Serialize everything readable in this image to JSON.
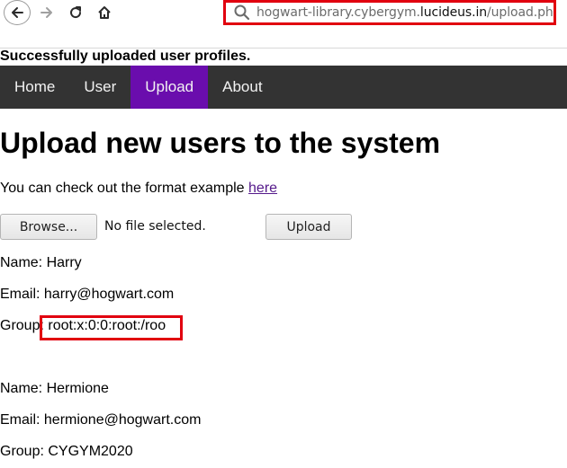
{
  "browser": {
    "url_prefix": "hogwart-library.cybergym.",
    "url_domain": "lucideus.in",
    "url_path": "/upload.php",
    "icons": [
      "back-arrow-icon",
      "forward-arrow-icon",
      "reload-icon",
      "home-icon",
      "search-icon"
    ],
    "highlight_color": "#e1000f"
  },
  "page": {
    "success_message": "Successfully uploaded user profiles.",
    "nav": [
      "Home",
      "User",
      "Upload",
      "About"
    ],
    "active_nav": "Upload",
    "nav_active_color": "#6a0dad",
    "title": "Upload new users to the system",
    "format_text": "You can check out the format example ",
    "format_link": "here",
    "browse_label": "Browse...",
    "file_status": "No file selected.",
    "upload_label": "Upload"
  },
  "users": [
    {
      "name": "Name: Harry",
      "email": "Email: harry@hogwart.com",
      "group": "Group: root:x:0:0:root:/roo"
    },
    {
      "name": "Name: Hermione",
      "email": "Email: hermione@hogwart.com",
      "group": "Group: CYGYM2020"
    }
  ]
}
